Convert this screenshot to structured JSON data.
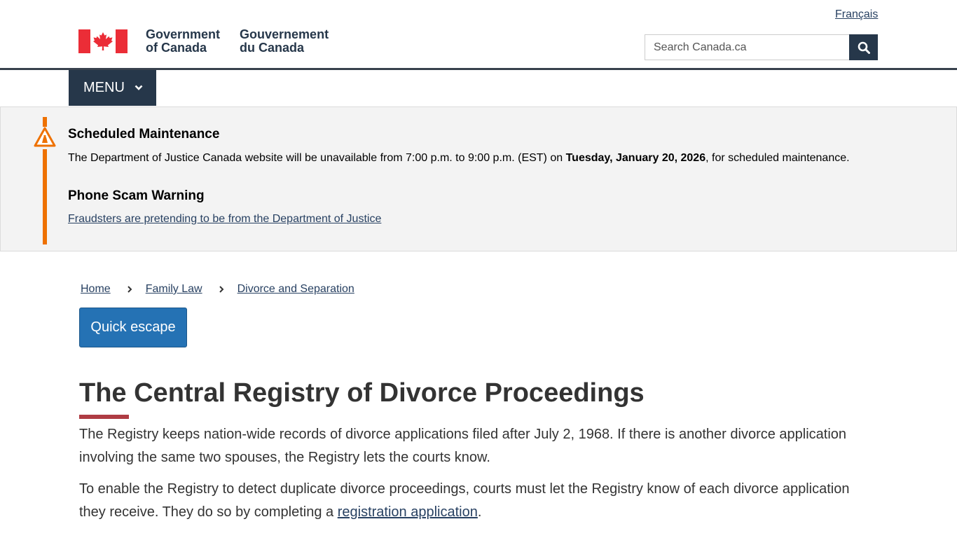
{
  "header": {
    "language_link": "Français",
    "wordmark_en_line1": "Government",
    "wordmark_en_line2": "of Canada",
    "wordmark_fr_line1": "Gouvernement",
    "wordmark_fr_line2": "du Canada",
    "search_placeholder": "Search Canada.ca",
    "search_button_icon": "search-icon",
    "flag_color": "#eb2d37"
  },
  "menu": {
    "label": "MENU",
    "icon": "chevron-down-icon"
  },
  "alert": {
    "icon": "warning-icon",
    "accent_color": "#ee7100",
    "maintenance_heading": "Scheduled Maintenance",
    "maintenance_text_before": "The Department of Justice Canada website will be unavailable from 7:00 p.m. to 9:00 p.m. (EST) on ",
    "maintenance_text_bold": "Tuesday, January 20, 2026",
    "maintenance_text_after": ", for scheduled maintenance.",
    "scam_heading": "Phone Scam Warning",
    "scam_link": "Fraudsters are pretending to be from the Department of Justice"
  },
  "breadcrumb": {
    "items": [
      "Home",
      "Family Law",
      "Divorce and Separation"
    ],
    "separator_icon": "chevron-right-icon"
  },
  "quick_escape": {
    "label": "Quick escape",
    "color": "#2572b4"
  },
  "main": {
    "title": "The Central Registry of Divorce Proceedings",
    "title_underline_color": "#af3c43",
    "paragraph1": "The Registry keeps nation-wide records of divorce applications filed after July 2, 1968. If there is another divorce application involving the same two spouses, the Registry lets the courts know.",
    "paragraph2_before": "To enable the Registry to detect duplicate divorce proceedings, courts must let the Registry know of each divorce application they receive. They do so by completing a ",
    "paragraph2_link": "registration application",
    "paragraph2_after": "."
  }
}
